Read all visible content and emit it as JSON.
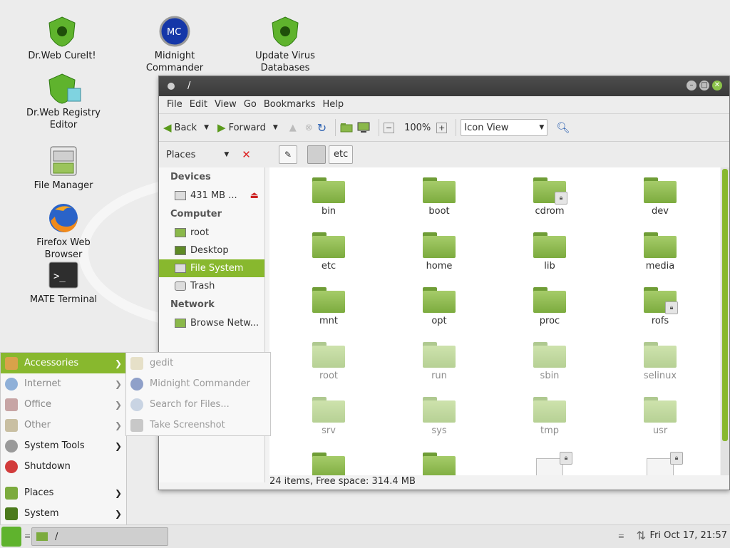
{
  "desktop": {
    "icons": [
      {
        "label": "Dr.Web CureIt!"
      },
      {
        "label": "Midnight Commander"
      },
      {
        "label": "Update Virus Databases"
      },
      {
        "label": "Dr.Web Registry Editor"
      },
      {
        "label": "File Manager"
      },
      {
        "label": "Firefox Web Browser"
      },
      {
        "label": "MATE Terminal"
      }
    ]
  },
  "window": {
    "title": "/",
    "menu": [
      "File",
      "Edit",
      "View",
      "Go",
      "Bookmarks",
      "Help"
    ],
    "toolbar": {
      "back": "Back",
      "forward": "Forward",
      "zoom": "100%",
      "view_mode": "Icon View"
    },
    "location": {
      "places_label": "Places",
      "path_button": "etc"
    },
    "sidebar": {
      "devices_header": "Devices",
      "device_item": "431 MB ...",
      "computer_header": "Computer",
      "computer_items": [
        "root",
        "Desktop",
        "File System",
        "Trash"
      ],
      "network_header": "Network",
      "network_items": [
        "Browse Netw..."
      ]
    },
    "files": [
      {
        "name": "bin",
        "locked": false
      },
      {
        "name": "boot",
        "locked": false
      },
      {
        "name": "cdrom",
        "locked": true
      },
      {
        "name": "dev",
        "locked": false
      },
      {
        "name": "etc",
        "locked": false
      },
      {
        "name": "home",
        "locked": false
      },
      {
        "name": "lib",
        "locked": false
      },
      {
        "name": "media",
        "locked": false
      },
      {
        "name": "mnt",
        "locked": false
      },
      {
        "name": "opt",
        "locked": false
      },
      {
        "name": "proc",
        "locked": false
      },
      {
        "name": "rofs",
        "locked": true
      },
      {
        "name": "root",
        "locked": false
      },
      {
        "name": "run",
        "locked": false
      },
      {
        "name": "sbin",
        "locked": false
      },
      {
        "name": "selinux",
        "locked": false
      },
      {
        "name": "srv",
        "locked": false
      },
      {
        "name": "sys",
        "locked": false
      },
      {
        "name": "tmp",
        "locked": false
      },
      {
        "name": "usr",
        "locked": false
      }
    ],
    "status": "24 items, Free space: 314.4 MB"
  },
  "menu": {
    "items": [
      "Accessories",
      "Internet",
      "Office",
      "Other",
      "System Tools",
      "Shutdown",
      "Places",
      "System"
    ],
    "accessories": [
      "gedit",
      "Midnight Commander",
      "Search for Files...",
      "Take Screenshot"
    ]
  },
  "panel": {
    "task_label": "/",
    "clock": "Fri Oct 17, 21:57"
  },
  "colors": {
    "accent": "#88b82e",
    "titlebar": "#3f3f3f",
    "folder": "#8ab84a"
  }
}
